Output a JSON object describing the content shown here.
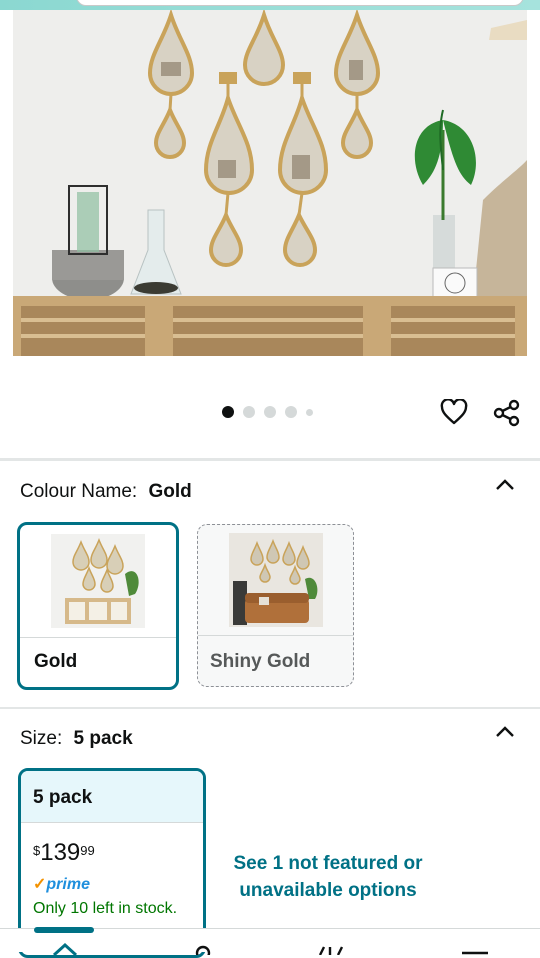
{
  "gallery": {
    "dot_count": 5,
    "active_dot": 0
  },
  "colour": {
    "label": "Colour Name:",
    "selected": "Gold",
    "options": [
      {
        "name": "Gold",
        "state": "selected"
      },
      {
        "name": "Shiny Gold",
        "state": "unavailable"
      }
    ]
  },
  "size": {
    "label": "Size:",
    "selected": "5 pack",
    "card": {
      "name": "5 pack",
      "currency": "$",
      "price_whole": "139",
      "price_fraction": "99",
      "prime_check": "✓",
      "prime_label": "prime",
      "stock": "Only 10 left in stock."
    },
    "see_more": "See 1 not featured or unavailable options"
  },
  "icons": {
    "wishlist": "heart-icon",
    "share": "share-icon",
    "collapse": "chevron-up-icon"
  },
  "colors": {
    "accent": "#007185",
    "selected_header_bg": "#e6f7fb",
    "stock_green": "#007600",
    "prime_blue": "#1f8fdd"
  }
}
